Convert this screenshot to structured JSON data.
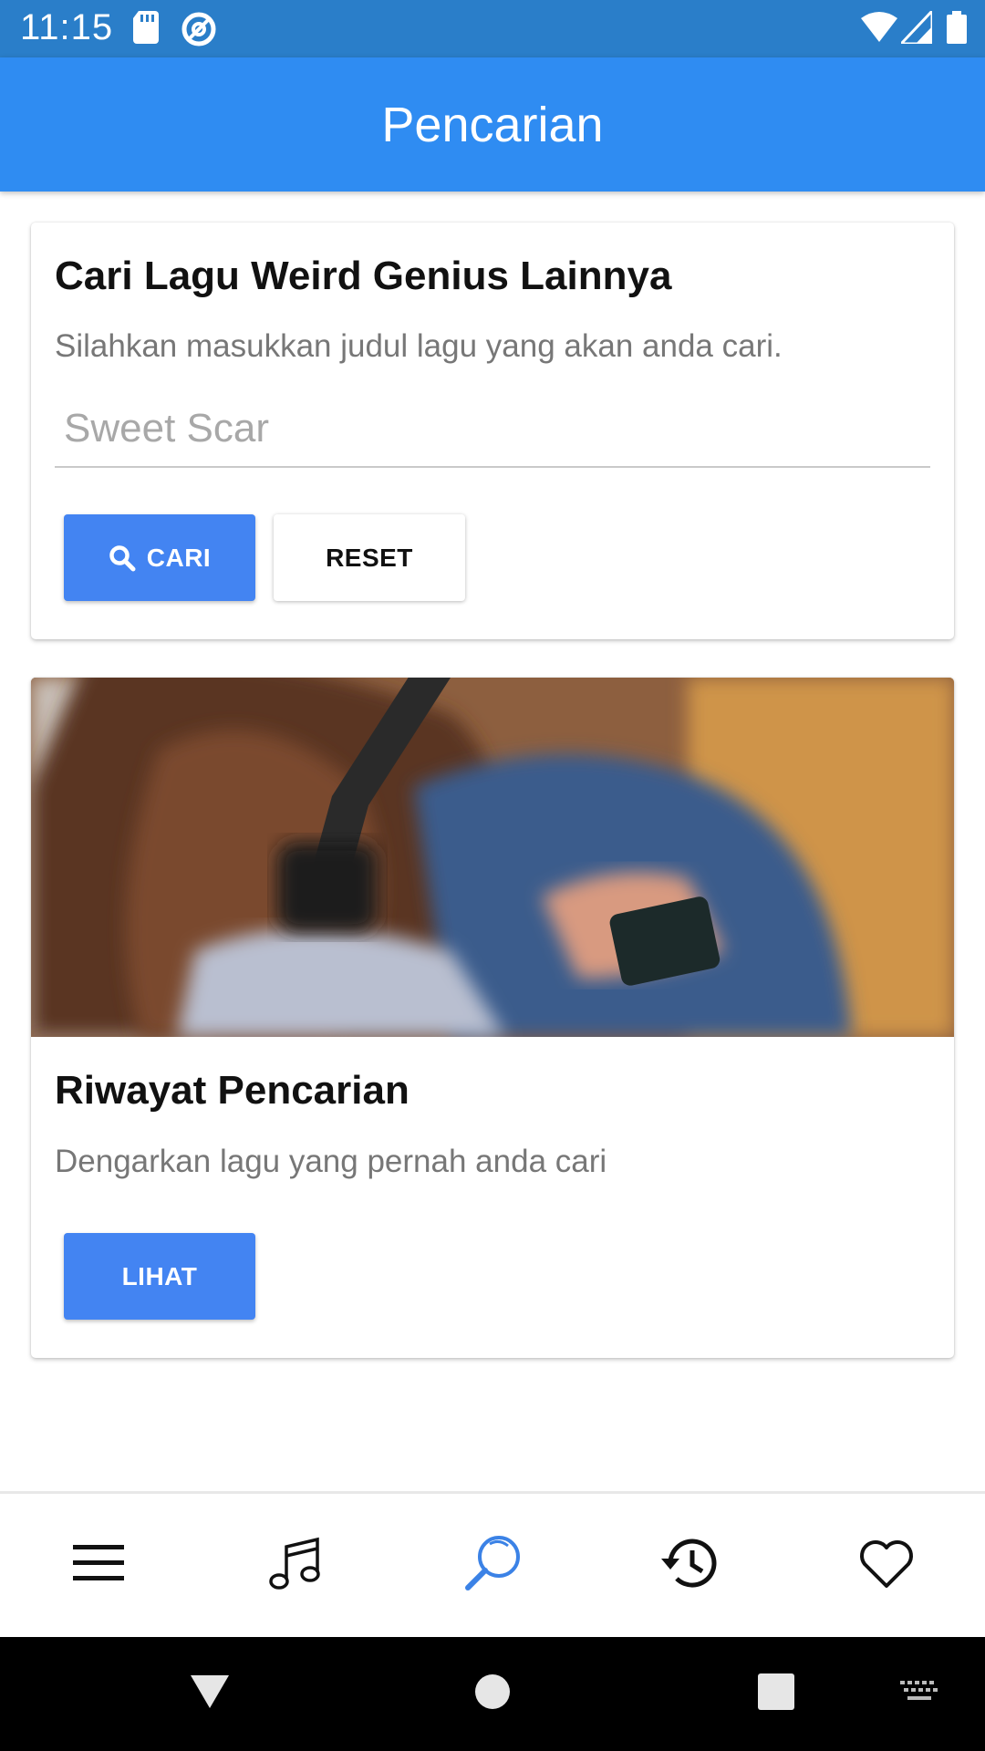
{
  "status_bar": {
    "time": "11:15",
    "icons": [
      "sd-card-icon",
      "at-sign-icon",
      "wifi-icon",
      "signal-icon",
      "battery-icon"
    ]
  },
  "app_bar": {
    "title": "Pencarian"
  },
  "search_card": {
    "title": "Cari Lagu Weird Genius Lainnya",
    "description": "Silahkan masukkan judul lagu yang akan anda cari.",
    "input_value": "",
    "input_placeholder": "Sweet Scar",
    "search_button": "CARI",
    "reset_button": "RESET"
  },
  "history_card": {
    "image_icon": "headphones-photo",
    "title": "Riwayat Pencarian",
    "description": "Dengarkan lagu yang pernah anda cari",
    "view_button": "LIHAT"
  },
  "bottom_nav": {
    "items": [
      "menu-icon",
      "music-note-icon",
      "search-icon",
      "history-icon",
      "heart-icon"
    ],
    "active": "search-icon"
  },
  "colors": {
    "status_bar": "#2a7ec9",
    "app_bar": "#2f8cf2",
    "primary_button": "#4384f2",
    "active_nav": "#3b82e6"
  }
}
